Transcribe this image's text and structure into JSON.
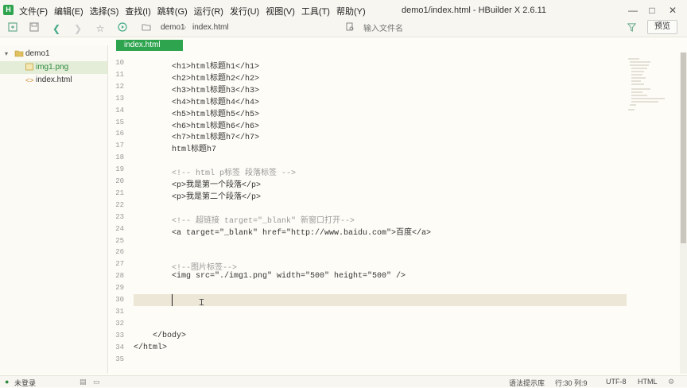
{
  "app": {
    "window_title": "demo1/index.html - HBuilder X 2.6.11",
    "icon_letter": "H",
    "menu": [
      "文件(F)",
      "编辑(E)",
      "选择(S)",
      "查找(I)",
      "跳转(G)",
      "运行(R)",
      "发行(U)",
      "视图(V)",
      "工具(T)",
      "帮助(Y)"
    ],
    "controls": {
      "minimize": "—",
      "maximize": "□",
      "close": "✕"
    }
  },
  "toolbar": {
    "breadcrumb": [
      "demo1",
      "index.html"
    ],
    "file_search_placeholder": "输入文件名",
    "preview_label": "预览"
  },
  "sidebar": {
    "project": "demo1",
    "files": [
      {
        "name": "img1.png",
        "type": "image",
        "selected": true
      },
      {
        "name": "index.html",
        "type": "html",
        "selected": false
      }
    ]
  },
  "editor": {
    "active_tab": "index.html",
    "lines": [
      {
        "no": "10",
        "code": "        <h1>html标题h1</h1>"
      },
      {
        "no": "11",
        "code": "        <h2>html标题h2</h2>"
      },
      {
        "no": "12",
        "code": "        <h3>html标题h3</h3>"
      },
      {
        "no": "13",
        "code": "        <h4>html标题h4</h4>"
      },
      {
        "no": "14",
        "code": "        <h5>html标题h5</h5>"
      },
      {
        "no": "15",
        "code": "        <h6>html标题h6</h6>"
      },
      {
        "no": "16",
        "code": "        <h7>html标题h7</h7>"
      },
      {
        "no": "17",
        "code": "        html标题h7"
      },
      {
        "no": "18",
        "code": ""
      },
      {
        "no": "19",
        "code": "        <!-- html p标签 段落标签 -->"
      },
      {
        "no": "20",
        "code": "        <p>我是第一个段落</p>"
      },
      {
        "no": "21",
        "code": "        <p>我是第二个段落</p>"
      },
      {
        "no": "22",
        "code": ""
      },
      {
        "no": "23",
        "code": "        <!-- 超链接 target=\"_blank\" 新窗口打开-->"
      },
      {
        "no": "24",
        "code": "        <a target=\"_blank\" href=\"http://www.baidu.com\">百度</a>"
      },
      {
        "no": "25",
        "code": ""
      },
      {
        "no": "26",
        "code": ""
      },
      {
        "no": "27",
        "code": "        <!--图片标签-->"
      },
      {
        "no": "28",
        "code": "        <img src=\"./img1.png\" width=\"500\" height=\"500\" />"
      },
      {
        "no": "29",
        "code": ""
      },
      {
        "no": "30",
        "code": ""
      },
      {
        "no": "31",
        "code": ""
      },
      {
        "no": "32",
        "code": ""
      },
      {
        "no": "33",
        "code": "    </body>"
      },
      {
        "no": "34",
        "code": "</html>"
      },
      {
        "no": "35",
        "code": ""
      }
    ]
  },
  "status": {
    "login": "未登录",
    "syntax_hint": "语法提示库",
    "position": "行:30  列:9",
    "encoding": "UTF-8",
    "language": "HTML"
  },
  "colors": {
    "accent": "#2ea44f",
    "tag": "#1a6bb8",
    "comment": "#999999"
  }
}
